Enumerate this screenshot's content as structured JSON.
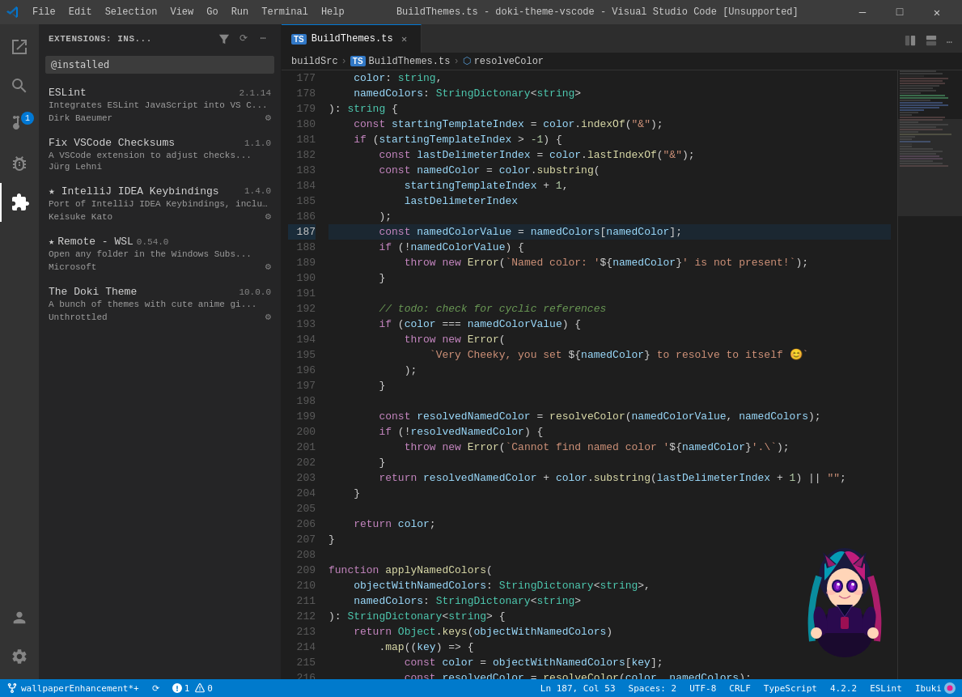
{
  "titlebar": {
    "title": "BuildThemes.ts - doki-theme-vscode - Visual Studio Code [Unsupported]",
    "menu_items": [
      "File",
      "Edit",
      "Selection",
      "View",
      "Go",
      "Run",
      "Terminal",
      "Help"
    ],
    "controls": [
      "—",
      "□",
      "✕"
    ]
  },
  "activitybar": {
    "items": [
      {
        "name": "explorer",
        "icon": "files",
        "active": false
      },
      {
        "name": "search",
        "icon": "search",
        "active": false
      },
      {
        "name": "source-control",
        "icon": "git",
        "active": false,
        "badge": "1"
      },
      {
        "name": "run-debug",
        "icon": "debug",
        "active": false
      },
      {
        "name": "extensions",
        "icon": "extensions",
        "active": true
      }
    ],
    "bottom_items": [
      {
        "name": "accounts",
        "icon": "account"
      },
      {
        "name": "settings",
        "icon": "settings"
      }
    ]
  },
  "sidebar": {
    "title": "Extensions: Ins...",
    "search_placeholder": "@installed",
    "extensions": [
      {
        "name": "ESLint",
        "version": "2.1.14",
        "description": "Integrates ESLint JavaScript into VS C...",
        "author": "Dirk Baeumer",
        "starred": false,
        "has_gear": true
      },
      {
        "name": "Fix VSCode Checksums",
        "version": "1.1.0",
        "description": "A VSCode extension to adjust checks...",
        "author": "Jürg Lehni",
        "starred": false,
        "has_gear": false
      },
      {
        "name": "IntelliJ IDEA Keybindings",
        "version": "1.4.0",
        "description": "Port of IntelliJ IDEA Keybindings, inclu...",
        "author": "Keisuke Kato",
        "starred": true,
        "has_gear": true
      },
      {
        "name": "Remote - WSL",
        "version": "0.54.0",
        "description": "Open any folder in the Windows Subs...",
        "author": "Microsoft",
        "starred": true,
        "has_gear": true
      },
      {
        "name": "The Doki Theme",
        "version": "10.0.0",
        "description": "A bunch of themes with cute anime gi...",
        "author": "Unthrottled",
        "starred": false,
        "has_gear": true
      }
    ]
  },
  "editor": {
    "tab_name": "BuildThemes.ts",
    "breadcrumb": [
      "buildSrc",
      "TS BuildThemes.ts",
      "resolveColor"
    ],
    "lines": [
      {
        "num": "177",
        "content": "    color: string,"
      },
      {
        "num": "178",
        "content": "    namedColors: StringDictonary<string>"
      },
      {
        "num": "179",
        "content": "): string {"
      },
      {
        "num": "180",
        "content": "    const startingTemplateIndex = color.indexOf(\"&\");"
      },
      {
        "num": "181",
        "content": "    if (startingTemplateIndex > -1) {"
      },
      {
        "num": "182",
        "content": "        const lastDelimeterIndex = color.lastIndexOf(\"&\");"
      },
      {
        "num": "183",
        "content": "        const namedColor = color.substring("
      },
      {
        "num": "184",
        "content": "            startingTemplateIndex + 1,"
      },
      {
        "num": "185",
        "content": "            lastDelimeterIndex"
      },
      {
        "num": "186",
        "content": "        );"
      },
      {
        "num": "187",
        "content": "        const namedColorValue = namedColors[namedColor];"
      },
      {
        "num": "188",
        "content": "        if (!namedColorValue) {"
      },
      {
        "num": "189",
        "content": "            throw new Error(`Named color: '${namedColor}' is not present!`);"
      },
      {
        "num": "190",
        "content": "        }"
      },
      {
        "num": "191",
        "content": ""
      },
      {
        "num": "192",
        "content": "        // todo: check for cyclic references"
      },
      {
        "num": "193",
        "content": "        if (color === namedColorValue) {"
      },
      {
        "num": "194",
        "content": "            throw new Error("
      },
      {
        "num": "195",
        "content": "                `Very Cheeky, you set ${namedColor} to resolve to itself 😊`"
      },
      {
        "num": "196",
        "content": "            );"
      },
      {
        "num": "197",
        "content": "        }"
      },
      {
        "num": "198",
        "content": ""
      },
      {
        "num": "199",
        "content": "        const resolvedNamedColor = resolveColor(namedColorValue, namedColors);"
      },
      {
        "num": "200",
        "content": "        if (!resolvedNamedColor) {"
      },
      {
        "num": "201",
        "content": "            throw new Error(`Cannot find named color '${namedColor}'.`);"
      },
      {
        "num": "202",
        "content": "        }"
      },
      {
        "num": "203",
        "content": "        return resolvedNamedColor + color.substring(lastDelimeterIndex + 1) || \"\";"
      },
      {
        "num": "204",
        "content": "    }"
      },
      {
        "num": "205",
        "content": ""
      },
      {
        "num": "206",
        "content": "    return color;"
      },
      {
        "num": "207",
        "content": "}"
      },
      {
        "num": "208",
        "content": ""
      },
      {
        "num": "209",
        "content": "function applyNamedColors("
      },
      {
        "num": "210",
        "content": "    objectWithNamedColors: StringDictonary<string>,"
      },
      {
        "num": "211",
        "content": "    namedColors: StringDictonary<string>"
      },
      {
        "num": "212",
        "content": "): StringDictonary<string> {"
      },
      {
        "num": "213",
        "content": "    return Object.keys(objectWithNamedColors)"
      },
      {
        "num": "214",
        "content": "        .map((key) => {"
      },
      {
        "num": "215",
        "content": "            const color = objectWithNamedColors[key];"
      },
      {
        "num": "216",
        "content": "            const resolvedColor = resolveColor(color, namedColors);"
      }
    ]
  },
  "statusbar": {
    "left_items": [
      "wallpaperEnhancement*+",
      "⟳",
      "⚠ 1  ⚠ 0"
    ],
    "right_items": [
      "Ln 187, Col 53",
      "Spaces: 2",
      "UTF-8",
      "CRLF",
      "TypeScript",
      "4.2.2",
      "ESLint",
      "Ibuki"
    ],
    "git_branch": "wallpaperEnhancement*+"
  }
}
